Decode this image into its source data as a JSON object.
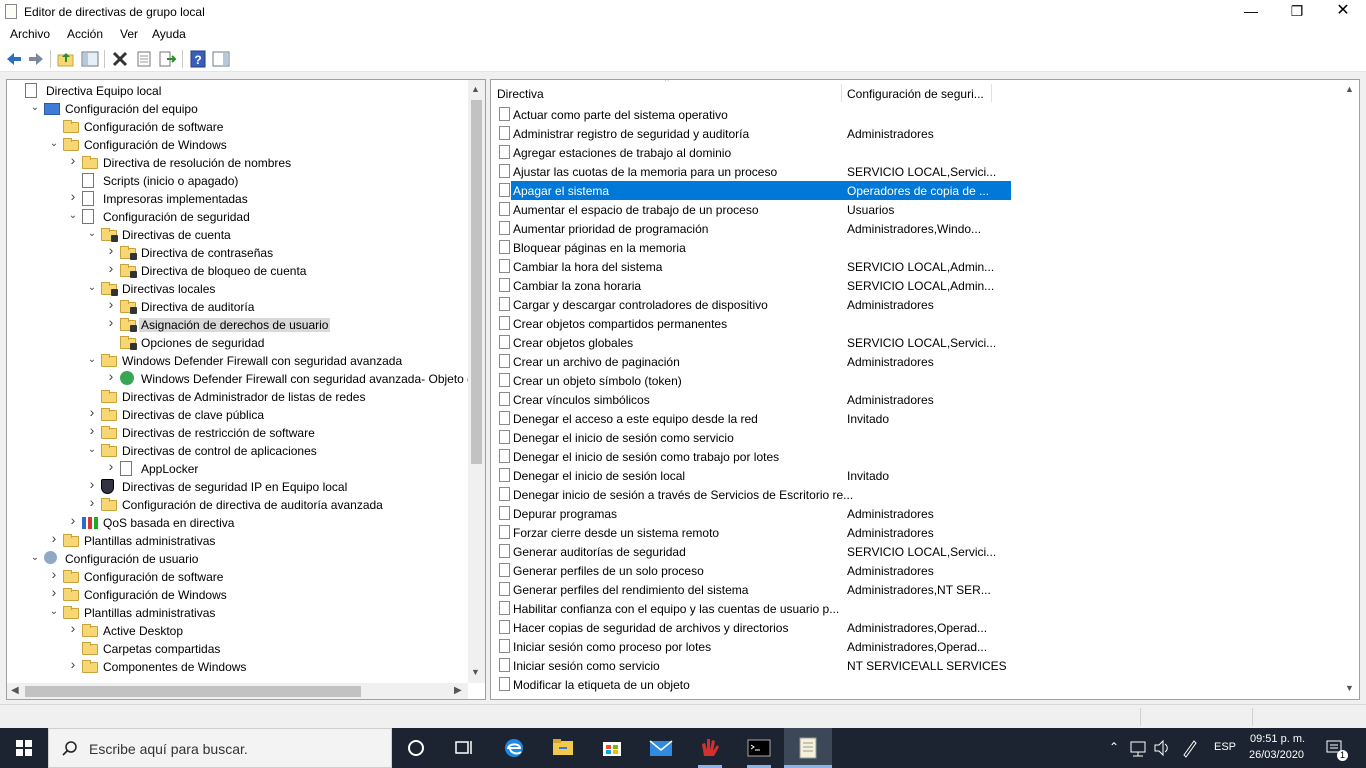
{
  "window": {
    "title": "Editor de directivas de grupo local"
  },
  "menu": [
    "Archivo",
    "Acción",
    "Ver",
    "Ayuda"
  ],
  "tree": [
    {
      "label": "Directiva Equipo local",
      "indent": 0,
      "arrow": "",
      "icon": "doc"
    },
    {
      "label": "Configuración del equipo",
      "indent": 1,
      "arrow": "v",
      "icon": "pc"
    },
    {
      "label": "Configuración de software",
      "indent": 2,
      "arrow": "",
      "icon": "folder"
    },
    {
      "label": "Configuración de Windows",
      "indent": 2,
      "arrow": "v",
      "icon": "folder"
    },
    {
      "label": "Directiva de resolución de nombres",
      "indent": 3,
      "arrow": ">",
      "icon": "folder"
    },
    {
      "label": "Scripts (inicio o apagado)",
      "indent": 3,
      "arrow": "",
      "icon": "doc"
    },
    {
      "label": "Impresoras implementadas",
      "indent": 3,
      "arrow": ">",
      "icon": "doc"
    },
    {
      "label": "Configuración de seguridad",
      "indent": 3,
      "arrow": "v",
      "icon": "doc"
    },
    {
      "label": "Directivas de cuenta",
      "indent": 4,
      "arrow": "v",
      "icon": "folder-lock"
    },
    {
      "label": "Directiva de contraseñas",
      "indent": 5,
      "arrow": ">",
      "icon": "folder-lock"
    },
    {
      "label": "Directiva de bloqueo de cuenta",
      "indent": 5,
      "arrow": ">",
      "icon": "folder-lock"
    },
    {
      "label": "Directivas locales",
      "indent": 4,
      "arrow": "v",
      "icon": "folder-lock"
    },
    {
      "label": "Directiva de auditoría",
      "indent": 5,
      "arrow": ">",
      "icon": "folder-lock"
    },
    {
      "label": "Asignación de derechos de usuario",
      "indent": 5,
      "arrow": ">",
      "icon": "folder-lock",
      "selected": true
    },
    {
      "label": "Opciones de seguridad",
      "indent": 5,
      "arrow": "",
      "icon": "folder-lock"
    },
    {
      "label": "Windows Defender Firewall con seguridad avanzada",
      "indent": 4,
      "arrow": "v",
      "icon": "folder"
    },
    {
      "label": "Windows Defender Firewall con seguridad avanzada- Objeto de d",
      "indent": 5,
      "arrow": ">",
      "icon": "globe"
    },
    {
      "label": "Directivas de Administrador de listas de redes",
      "indent": 4,
      "arrow": "",
      "icon": "folder"
    },
    {
      "label": "Directivas de clave pública",
      "indent": 4,
      "arrow": ">",
      "icon": "folder"
    },
    {
      "label": "Directivas de restricción de software",
      "indent": 4,
      "arrow": ">",
      "icon": "folder"
    },
    {
      "label": "Directivas de control de aplicaciones",
      "indent": 4,
      "arrow": "v",
      "icon": "folder"
    },
    {
      "label": "AppLocker",
      "indent": 5,
      "arrow": ">",
      "icon": "doc"
    },
    {
      "label": "Directivas de seguridad IP en Equipo local",
      "indent": 4,
      "arrow": ">",
      "icon": "shield"
    },
    {
      "label": "Configuración de directiva de auditoría avanzada",
      "indent": 4,
      "arrow": ">",
      "icon": "folder"
    },
    {
      "label": "QoS basada en directiva",
      "indent": 3,
      "arrow": ">",
      "icon": "chart"
    },
    {
      "label": "Plantillas administrativas",
      "indent": 2,
      "arrow": ">",
      "icon": "folder"
    },
    {
      "label": "Configuración de usuario",
      "indent": 1,
      "arrow": "v",
      "icon": "user"
    },
    {
      "label": "Configuración de software",
      "indent": 2,
      "arrow": ">",
      "icon": "folder"
    },
    {
      "label": "Configuración de Windows",
      "indent": 2,
      "arrow": ">",
      "icon": "folder"
    },
    {
      "label": "Plantillas administrativas",
      "indent": 2,
      "arrow": "v",
      "icon": "folder"
    },
    {
      "label": "Active Desktop",
      "indent": 3,
      "arrow": ">",
      "icon": "folder"
    },
    {
      "label": "Carpetas compartidas",
      "indent": 3,
      "arrow": "",
      "icon": "folder"
    },
    {
      "label": "Componentes de Windows",
      "indent": 3,
      "arrow": ">",
      "icon": "folder"
    }
  ],
  "list": {
    "headers": {
      "policy": "Directiva",
      "setting": "Configuración de seguri..."
    },
    "rows": [
      {
        "policy": "Actuar como parte del sistema operativo",
        "setting": ""
      },
      {
        "policy": "Administrar registro de seguridad y auditoría",
        "setting": "Administradores"
      },
      {
        "policy": "Agregar estaciones de trabajo al dominio",
        "setting": ""
      },
      {
        "policy": "Ajustar las cuotas de la memoria para un proceso",
        "setting": "SERVICIO LOCAL,Servici..."
      },
      {
        "policy": "Apagar el sistema",
        "setting": "Operadores de copia de ...",
        "selected": true
      },
      {
        "policy": "Aumentar el espacio de trabajo de un proceso",
        "setting": "Usuarios"
      },
      {
        "policy": "Aumentar prioridad de programación",
        "setting": "Administradores,Windo..."
      },
      {
        "policy": "Bloquear páginas en la memoria",
        "setting": ""
      },
      {
        "policy": "Cambiar la hora del sistema",
        "setting": "SERVICIO LOCAL,Admin..."
      },
      {
        "policy": "Cambiar la zona horaria",
        "setting": "SERVICIO LOCAL,Admin..."
      },
      {
        "policy": "Cargar y descargar controladores de dispositivo",
        "setting": "Administradores"
      },
      {
        "policy": "Crear objetos compartidos permanentes",
        "setting": ""
      },
      {
        "policy": "Crear objetos globales",
        "setting": "SERVICIO LOCAL,Servici..."
      },
      {
        "policy": "Crear un archivo de paginación",
        "setting": "Administradores"
      },
      {
        "policy": "Crear un objeto símbolo (token)",
        "setting": ""
      },
      {
        "policy": "Crear vínculos simbólicos",
        "setting": "Administradores"
      },
      {
        "policy": "Denegar el acceso a este equipo desde la red",
        "setting": "Invitado"
      },
      {
        "policy": "Denegar el inicio de sesión como servicio",
        "setting": ""
      },
      {
        "policy": "Denegar el inicio de sesión como trabajo por lotes",
        "setting": ""
      },
      {
        "policy": "Denegar el inicio de sesión local",
        "setting": "Invitado"
      },
      {
        "policy": "Denegar inicio de sesión a través de Servicios de Escritorio re...",
        "setting": ""
      },
      {
        "policy": "Depurar programas",
        "setting": "Administradores"
      },
      {
        "policy": "Forzar cierre desde un sistema remoto",
        "setting": "Administradores"
      },
      {
        "policy": "Generar auditorías de seguridad",
        "setting": "SERVICIO LOCAL,Servici..."
      },
      {
        "policy": "Generar perfiles de un solo proceso",
        "setting": "Administradores"
      },
      {
        "policy": "Generar perfiles del rendimiento del sistema",
        "setting": "Administradores,NT SER..."
      },
      {
        "policy": "Habilitar confianza con el equipo y las cuentas de usuario p...",
        "setting": ""
      },
      {
        "policy": "Hacer copias de seguridad de archivos y directorios",
        "setting": "Administradores,Operad..."
      },
      {
        "policy": "Iniciar sesión como proceso por lotes",
        "setting": "Administradores,Operad..."
      },
      {
        "policy": "Iniciar sesión como servicio",
        "setting": "NT SERVICE\\ALL SERVICES"
      },
      {
        "policy": "Modificar la etiqueta de un objeto",
        "setting": ""
      }
    ]
  },
  "taskbar": {
    "search_placeholder": "Escribe aquí para buscar.",
    "language": "ESP",
    "time": "09:51 p. m.",
    "date": "26/03/2020",
    "notifications": "1"
  }
}
